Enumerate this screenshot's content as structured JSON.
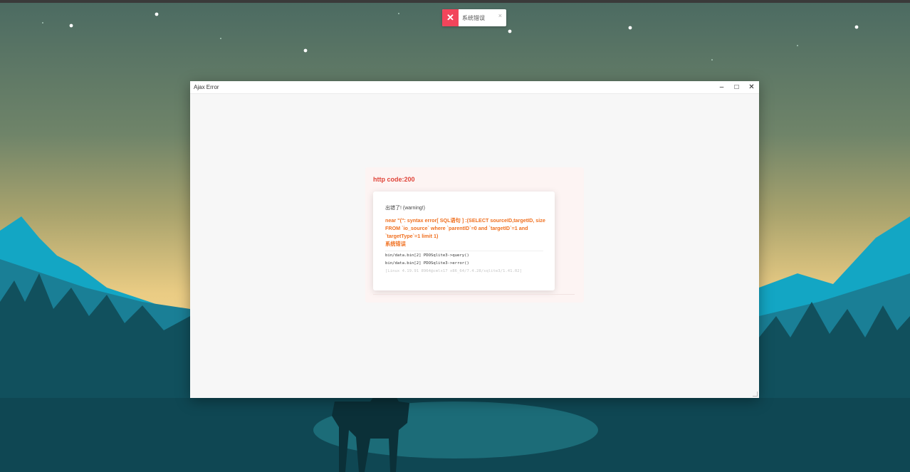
{
  "colors": {
    "toast_error": "#f2455b",
    "error_heading": "#e0453a",
    "error_message": "#f07020",
    "window_bg": "#f7f7f7"
  },
  "toast": {
    "icon": "close-icon",
    "text": "系统错误",
    "close_label": "×"
  },
  "window": {
    "title": "Ajax Error",
    "buttons": {
      "minimize": "–",
      "maximize": "□",
      "close": "✕"
    }
  },
  "error": {
    "heading": "http code:200",
    "subtitle": "出错了! (warning!)",
    "message": "near \"(\": syntax error[ SQL语句 ] :(SELECT sourceID,targetID, size FROM `io_source` where `parentID`=0 and `targetID`=1 and `targetType`=1 limit 1)",
    "message_tail": "系统错误",
    "trace": [
      "bin/data.bin[2] PDOSqlite3->query()",
      "bin/data.bin[2] PDOSqlite3->error()"
    ],
    "env": "[Linux 4.19.91 8964@cmlx17 x86_64/7.4.28/sqlite3/1.41.02]"
  }
}
